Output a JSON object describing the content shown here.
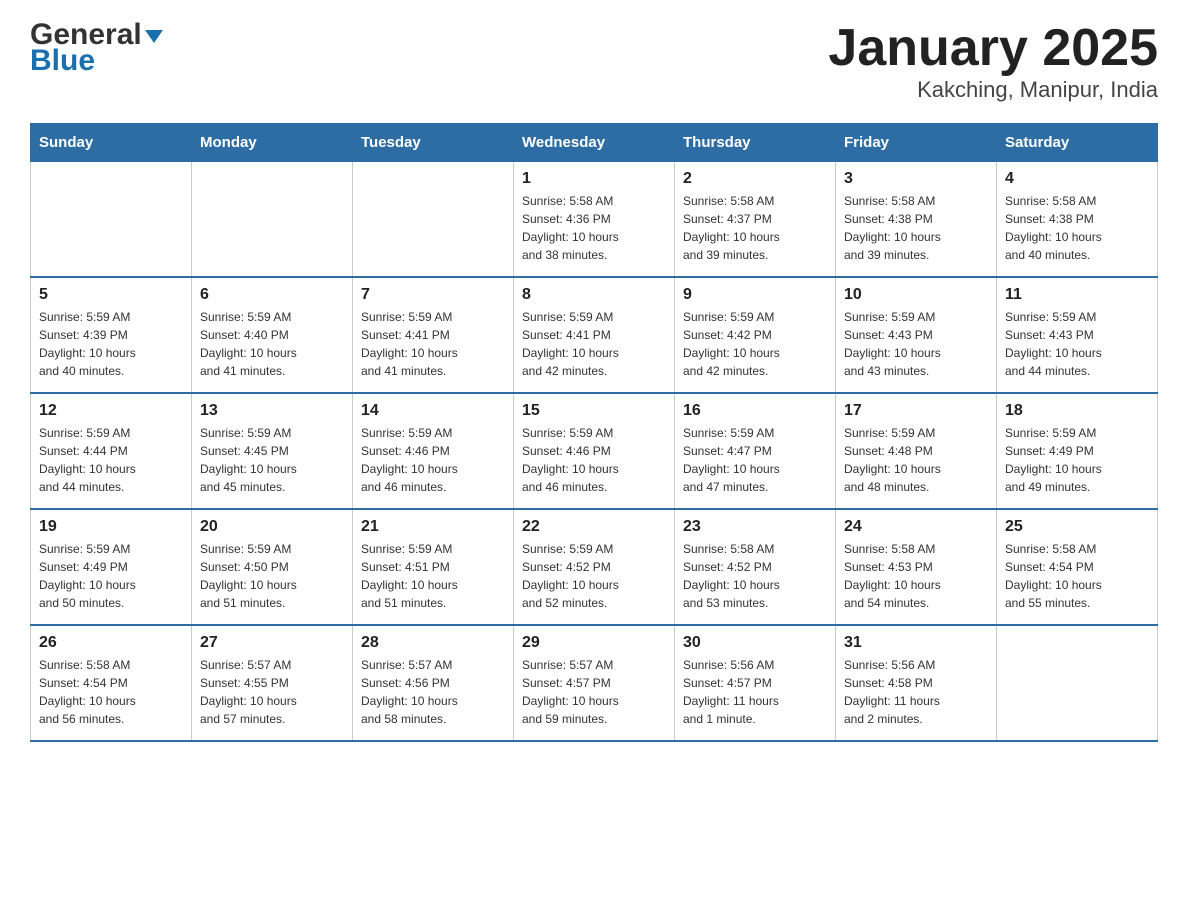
{
  "logo": {
    "name_black": "General",
    "name_blue": "Blue"
  },
  "title": "January 2025",
  "subtitle": "Kakching, Manipur, India",
  "header_days": [
    "Sunday",
    "Monday",
    "Tuesday",
    "Wednesday",
    "Thursday",
    "Friday",
    "Saturday"
  ],
  "weeks": [
    [
      {
        "day": "",
        "info": ""
      },
      {
        "day": "",
        "info": ""
      },
      {
        "day": "",
        "info": ""
      },
      {
        "day": "1",
        "info": "Sunrise: 5:58 AM\nSunset: 4:36 PM\nDaylight: 10 hours\nand 38 minutes."
      },
      {
        "day": "2",
        "info": "Sunrise: 5:58 AM\nSunset: 4:37 PM\nDaylight: 10 hours\nand 39 minutes."
      },
      {
        "day": "3",
        "info": "Sunrise: 5:58 AM\nSunset: 4:38 PM\nDaylight: 10 hours\nand 39 minutes."
      },
      {
        "day": "4",
        "info": "Sunrise: 5:58 AM\nSunset: 4:38 PM\nDaylight: 10 hours\nand 40 minutes."
      }
    ],
    [
      {
        "day": "5",
        "info": "Sunrise: 5:59 AM\nSunset: 4:39 PM\nDaylight: 10 hours\nand 40 minutes."
      },
      {
        "day": "6",
        "info": "Sunrise: 5:59 AM\nSunset: 4:40 PM\nDaylight: 10 hours\nand 41 minutes."
      },
      {
        "day": "7",
        "info": "Sunrise: 5:59 AM\nSunset: 4:41 PM\nDaylight: 10 hours\nand 41 minutes."
      },
      {
        "day": "8",
        "info": "Sunrise: 5:59 AM\nSunset: 4:41 PM\nDaylight: 10 hours\nand 42 minutes."
      },
      {
        "day": "9",
        "info": "Sunrise: 5:59 AM\nSunset: 4:42 PM\nDaylight: 10 hours\nand 42 minutes."
      },
      {
        "day": "10",
        "info": "Sunrise: 5:59 AM\nSunset: 4:43 PM\nDaylight: 10 hours\nand 43 minutes."
      },
      {
        "day": "11",
        "info": "Sunrise: 5:59 AM\nSunset: 4:43 PM\nDaylight: 10 hours\nand 44 minutes."
      }
    ],
    [
      {
        "day": "12",
        "info": "Sunrise: 5:59 AM\nSunset: 4:44 PM\nDaylight: 10 hours\nand 44 minutes."
      },
      {
        "day": "13",
        "info": "Sunrise: 5:59 AM\nSunset: 4:45 PM\nDaylight: 10 hours\nand 45 minutes."
      },
      {
        "day": "14",
        "info": "Sunrise: 5:59 AM\nSunset: 4:46 PM\nDaylight: 10 hours\nand 46 minutes."
      },
      {
        "day": "15",
        "info": "Sunrise: 5:59 AM\nSunset: 4:46 PM\nDaylight: 10 hours\nand 46 minutes."
      },
      {
        "day": "16",
        "info": "Sunrise: 5:59 AM\nSunset: 4:47 PM\nDaylight: 10 hours\nand 47 minutes."
      },
      {
        "day": "17",
        "info": "Sunrise: 5:59 AM\nSunset: 4:48 PM\nDaylight: 10 hours\nand 48 minutes."
      },
      {
        "day": "18",
        "info": "Sunrise: 5:59 AM\nSunset: 4:49 PM\nDaylight: 10 hours\nand 49 minutes."
      }
    ],
    [
      {
        "day": "19",
        "info": "Sunrise: 5:59 AM\nSunset: 4:49 PM\nDaylight: 10 hours\nand 50 minutes."
      },
      {
        "day": "20",
        "info": "Sunrise: 5:59 AM\nSunset: 4:50 PM\nDaylight: 10 hours\nand 51 minutes."
      },
      {
        "day": "21",
        "info": "Sunrise: 5:59 AM\nSunset: 4:51 PM\nDaylight: 10 hours\nand 51 minutes."
      },
      {
        "day": "22",
        "info": "Sunrise: 5:59 AM\nSunset: 4:52 PM\nDaylight: 10 hours\nand 52 minutes."
      },
      {
        "day": "23",
        "info": "Sunrise: 5:58 AM\nSunset: 4:52 PM\nDaylight: 10 hours\nand 53 minutes."
      },
      {
        "day": "24",
        "info": "Sunrise: 5:58 AM\nSunset: 4:53 PM\nDaylight: 10 hours\nand 54 minutes."
      },
      {
        "day": "25",
        "info": "Sunrise: 5:58 AM\nSunset: 4:54 PM\nDaylight: 10 hours\nand 55 minutes."
      }
    ],
    [
      {
        "day": "26",
        "info": "Sunrise: 5:58 AM\nSunset: 4:54 PM\nDaylight: 10 hours\nand 56 minutes."
      },
      {
        "day": "27",
        "info": "Sunrise: 5:57 AM\nSunset: 4:55 PM\nDaylight: 10 hours\nand 57 minutes."
      },
      {
        "day": "28",
        "info": "Sunrise: 5:57 AM\nSunset: 4:56 PM\nDaylight: 10 hours\nand 58 minutes."
      },
      {
        "day": "29",
        "info": "Sunrise: 5:57 AM\nSunset: 4:57 PM\nDaylight: 10 hours\nand 59 minutes."
      },
      {
        "day": "30",
        "info": "Sunrise: 5:56 AM\nSunset: 4:57 PM\nDaylight: 11 hours\nand 1 minute."
      },
      {
        "day": "31",
        "info": "Sunrise: 5:56 AM\nSunset: 4:58 PM\nDaylight: 11 hours\nand 2 minutes."
      },
      {
        "day": "",
        "info": ""
      }
    ]
  ]
}
